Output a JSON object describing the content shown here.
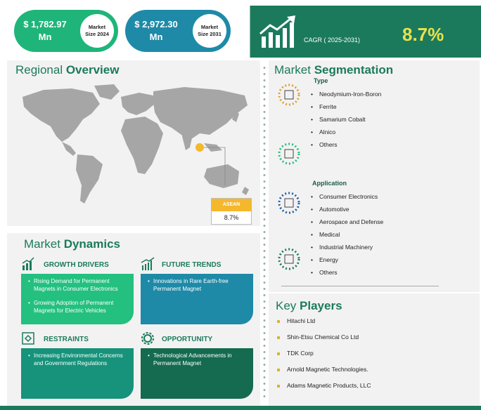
{
  "header": {
    "market_size_2024": {
      "value": "$ 1,782.97",
      "unit": "Mn",
      "badge_line1": "Market",
      "badge_line2": "Size 2024"
    },
    "market_size_2031": {
      "value": "$ 2,972.30",
      "unit": "Mn",
      "badge_line1": "Market",
      "badge_line2": "Size 2031"
    },
    "cagr_label": "CAGR ( 2025-2031)",
    "cagr_value": "8.7%",
    "cagr_icon": "growth-chart-icon"
  },
  "regional": {
    "title_light": "Regional ",
    "title_bold": "Overview",
    "highlight_label": "ASEAN",
    "highlight_value": "8.7%"
  },
  "dynamics": {
    "title_light": "Market ",
    "title_bold": "Dynamics",
    "growth_drivers": {
      "heading": "GROWTH DRIVERS",
      "icon": "bar-chart-icon",
      "items": [
        "Rising Demand for Permanent Magnets in Consumer Electronics",
        "Growing Adoption of Permanent Magnets for Electric Vehicles"
      ]
    },
    "future_trends": {
      "heading": "FUTURE TRENDS",
      "icon": "trend-chart-icon",
      "items": [
        "Innovations in Rare Earth-free Permanent Magnet"
      ]
    },
    "restraints": {
      "heading": "RESTRAINTS",
      "icon": "restraint-icon",
      "items": [
        "Increasing Environmental Concerns and Government Regulations"
      ]
    },
    "opportunity": {
      "heading": "OPPORTUNITY",
      "icon": "gear-icon",
      "items": [
        "Technological Advancements in Permanent Magnet"
      ]
    }
  },
  "segmentation": {
    "title_light": "Market ",
    "title_bold": "Segmentation",
    "type": {
      "heading": "Type",
      "items": [
        "Neodymium-Iron-Boron",
        "Ferrite",
        "Samarium Cobalt",
        "Alnico",
        "Others"
      ]
    },
    "application": {
      "heading": "Application",
      "items": [
        "Consumer Electronics",
        "Automotive",
        "Aerospace and Defense",
        "Medical",
        "Industrial Machinery",
        "Energy",
        "Others"
      ]
    }
  },
  "key_players": {
    "title_light": "Key ",
    "title_bold": "Players",
    "items": [
      "Hitachi Ltd",
      "Shin-Etsu Chemical Co Ltd",
      "TDK Corp",
      "Arnold Magnetic Technologies.",
      "Adams Magnetic Products, LLC"
    ]
  },
  "colors": {
    "brand_green": "#1b7a5c",
    "bright_green": "#23c07f",
    "teal": "#1e8aa8",
    "accent_yellow": "#e8e24a",
    "asean_orange": "#f5b82c",
    "map_gray": "#a6a6a6"
  }
}
